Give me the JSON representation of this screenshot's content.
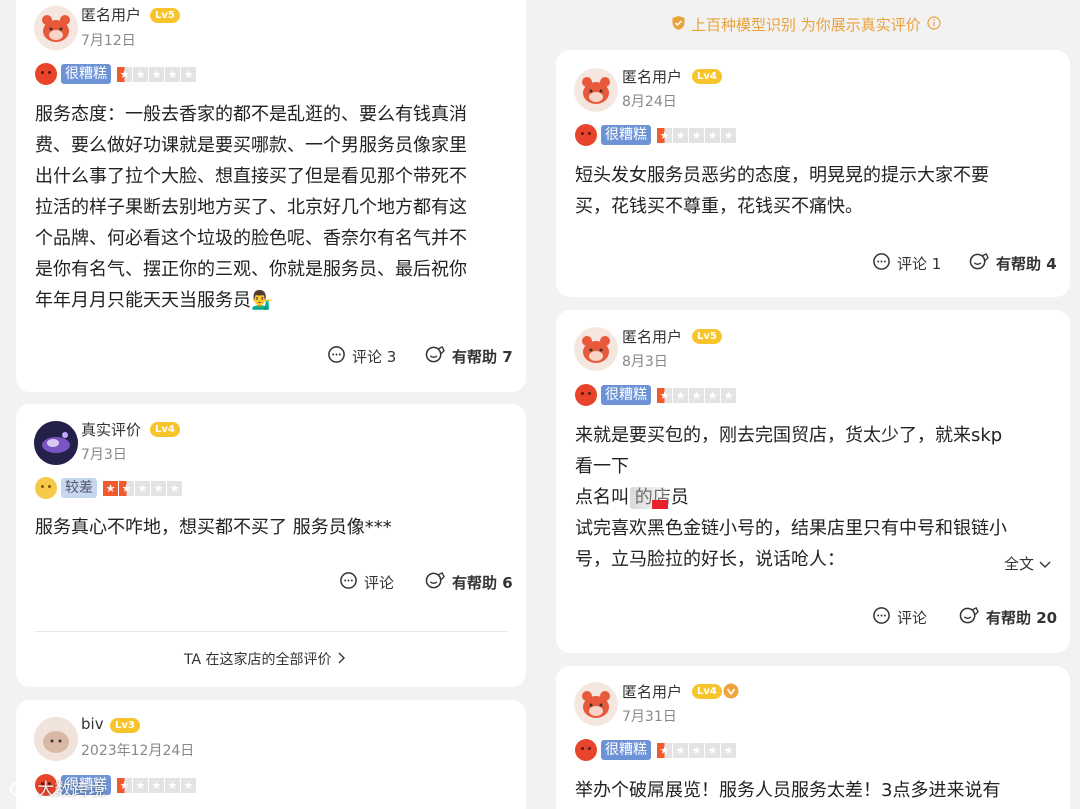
{
  "top_note": "上百种模型识别 为你展示真实评价",
  "show_all_link": "TA 在这家店的全部评价",
  "full_text_label": "全文",
  "watermark": "大数跨境",
  "reviews": [
    {
      "user": "匿名用户",
      "level": "Lv5",
      "date": "7月12日",
      "rating_label": "很糟糕",
      "stars": 0.5,
      "text": [
        "服务态度：一般去香家的都不是乱逛的、要么有钱真消",
        "费、要么做好功课就是要买哪款、一个男服务员像家里",
        "出什么事了拉个大脸、想直接买了但是看见那个带死不",
        "拉活的样子果断去别地方买了、北京好几个地方都有这",
        "个品牌、何必看这个垃圾的脸色呢、香奈尔有名气并不",
        "是你有名气、摆正你的三观、你就是服务员、最后祝你",
        "年年月月只能天天当服务员💁‍♂️"
      ],
      "comment_label": "评论 3",
      "helpful_label": "有帮助 7"
    },
    {
      "user": "真实评价",
      "level": "Lv4",
      "date": "7月3日",
      "rating_label": "较差",
      "stars": 1.5,
      "text": [
        "服务真心不咋地，想买都不买了 服务员像***"
      ],
      "comment_label": "评论",
      "helpful_label": "有帮助 6"
    },
    {
      "user": "biv",
      "level": "Lv3",
      "date": "2023年12月24日",
      "rating_label": "很糟糕",
      "stars": 0.5
    },
    {
      "user": "匿名用户",
      "level": "Lv4",
      "date": "8月24日",
      "rating_label": "很糟糕",
      "stars": 0.5,
      "text": [
        "短头发女服务员恶劣的态度，明晃晃的提示大家不要",
        "买，花钱买不尊重，花钱买不痛快。"
      ],
      "comment_label": "评论 1",
      "helpful_label": "有帮助 4"
    },
    {
      "user": "匿名用户",
      "level": "Lv5",
      "date": "8月3日",
      "rating_label": "很糟糕",
      "stars": 0.5,
      "text": [
        "来就是要买包的，刚去完国贸店，货太少了，就来skp",
        "看一下",
        "点名叫        的店员",
        "试完喜欢黑色金链小号的，结果店里只有中号和银链小",
        "号，立马脸拉的好长，说话呛人："
      ],
      "comment_label": "评论",
      "helpful_label": "有帮助 20"
    },
    {
      "user": "匿名用户",
      "level": "Lv4",
      "date": "7月31日",
      "rating_label": "很糟糕",
      "stars": 0.5,
      "text": [
        "举办个破屌展览！服务人员服务太差！3点多进来说有"
      ]
    }
  ],
  "colors": {
    "accent": "#f25a2d",
    "level_badge": "#f7c42b",
    "note": "#e9a23c"
  }
}
